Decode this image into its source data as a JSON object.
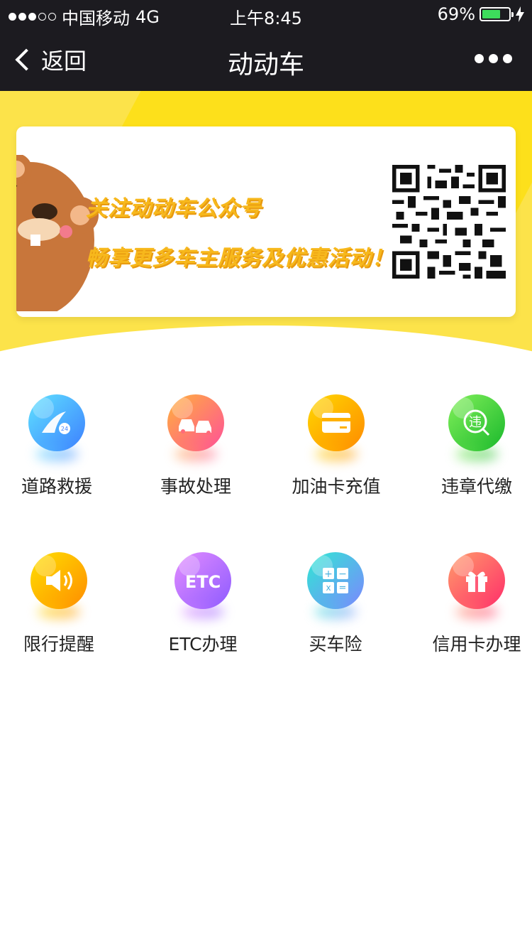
{
  "status_bar": {
    "carrier": "中国移动",
    "network": "4G",
    "time": "上午8:45",
    "battery_percent": "69%",
    "battery_level": 0.69,
    "battery_color": "#3ddc5c"
  },
  "nav": {
    "back_label": "返回",
    "title": "动动车"
  },
  "promo": {
    "line1": "关注动动车公众号",
    "line2": "畅享更多车主服务及优惠活动！"
  },
  "colors": {
    "header_bg": "#1c1b20",
    "brand_yellow": "#fde01b",
    "promo_text": "#f7b81c"
  },
  "services": {
    "row1": [
      {
        "label": "道路救援",
        "icon": "road-rescue-24-icon"
      },
      {
        "label": "事故处理",
        "icon": "car-accident-icon"
      },
      {
        "label": "加油卡充值",
        "icon": "fuel-card-icon"
      },
      {
        "label": "违章代缴",
        "icon": "violation-payment-icon"
      }
    ],
    "row2": [
      {
        "label": "限行提醒",
        "icon": "speaker-icon"
      },
      {
        "label": "ETC办理",
        "icon": "etc-icon"
      },
      {
        "label": "买车险",
        "icon": "calculator-icon"
      },
      {
        "label": "信用卡办理",
        "icon": "gift-icon"
      }
    ]
  }
}
